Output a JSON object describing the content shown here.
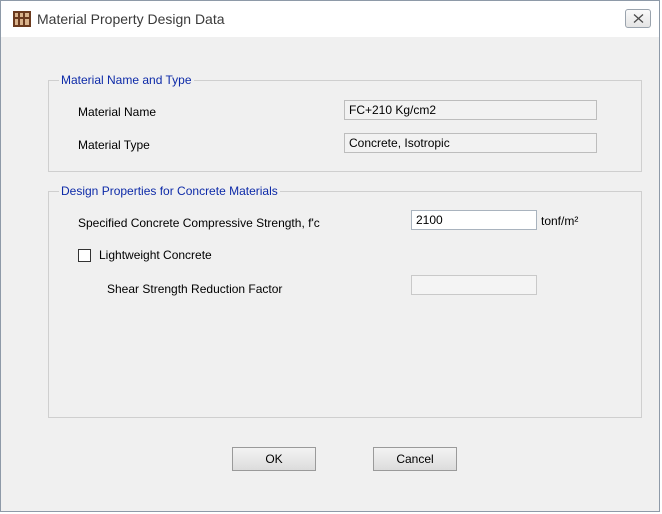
{
  "window": {
    "title": "Material Property Design Data",
    "app_icon": "etabs-app-icon",
    "close_icon": "close-icon"
  },
  "material_group": {
    "title": "Material Name and Type",
    "name_label": "Material Name",
    "name_value": "FC+210 Kg/cm2",
    "type_label": "Material Type",
    "type_value": "Concrete, Isotropic"
  },
  "design_group": {
    "title": "Design Properties for Concrete Materials",
    "fc_label": "Specified Concrete Compressive Strength, f'c",
    "fc_value": "2100",
    "fc_unit": "tonf/m²",
    "lightweight_label": "Lightweight Concrete",
    "lightweight_checked": false,
    "shear_label": "Shear Strength Reduction Factor",
    "shear_value": ""
  },
  "buttons": {
    "ok": "OK",
    "cancel": "Cancel"
  }
}
